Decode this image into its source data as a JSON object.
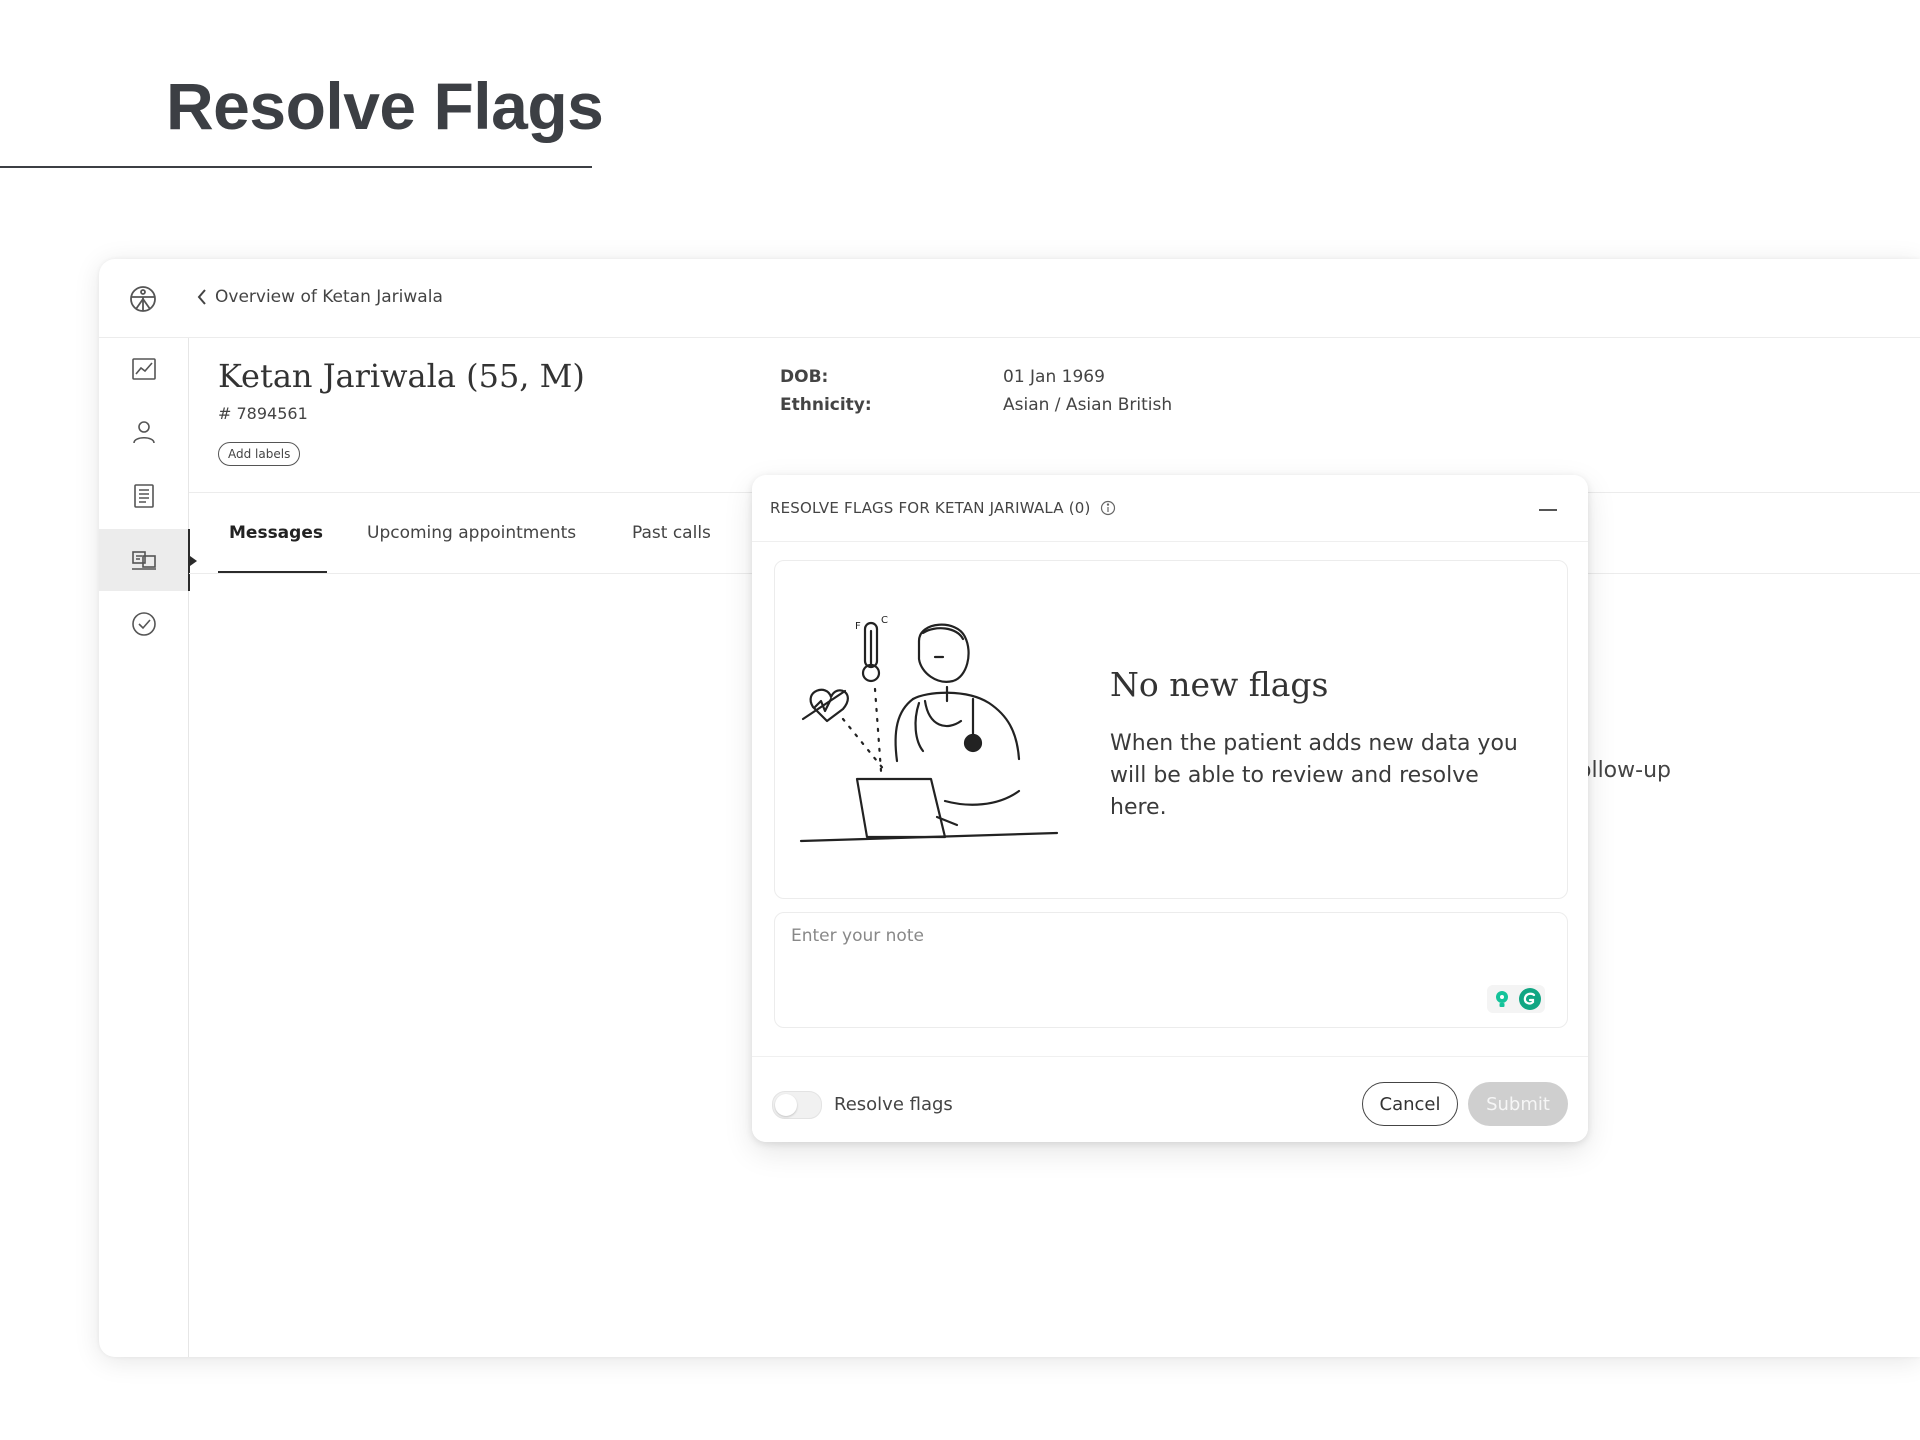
{
  "page": {
    "title": "Resolve Flags"
  },
  "nav": {
    "back_label": "Overview of Ketan Jariwala"
  },
  "sidebar": {
    "items": [
      {
        "name": "trends",
        "icon": "chart-icon"
      },
      {
        "name": "profile",
        "icon": "user-icon"
      },
      {
        "name": "notes",
        "icon": "document-icon"
      },
      {
        "name": "communications",
        "icon": "chat-icon",
        "active": true
      },
      {
        "name": "tasks",
        "icon": "check-circle-icon"
      }
    ]
  },
  "patient": {
    "name": "Ketan Jariwala (55, M)",
    "id": "# 7894561",
    "add_labels": "Add labels",
    "dob_label": "DOB:",
    "dob_value": "01 Jan 1969",
    "ethnicity_label": "Ethnicity:",
    "ethnicity_value": "Asian / Asian British"
  },
  "tabs": [
    {
      "label": "Messages",
      "active": true
    },
    {
      "label": "Upcoming appointments"
    },
    {
      "label": "Past calls"
    }
  ],
  "background_partial_text": "ollow-up",
  "modal": {
    "title": "RESOLVE FLAGS FOR KETAN JARIWALA (0)",
    "empty_title": "No new flags",
    "empty_description": "When the patient adds new data you will be able to review and resolve here.",
    "note_placeholder": "Enter your note",
    "toggle_label": "Resolve flags",
    "toggle_on": false,
    "cancel_label": "Cancel",
    "submit_label": "Submit",
    "submit_disabled": true
  },
  "colors": {
    "grammarly_green": "#15c39a",
    "grammarly_dark": "#11a683",
    "submit_disabled": "#cfcfcf"
  }
}
